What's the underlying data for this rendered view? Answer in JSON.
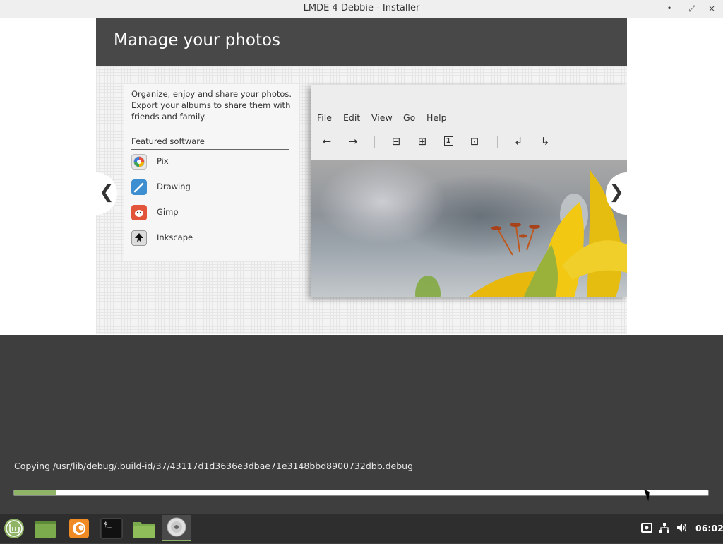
{
  "window": {
    "title": "LMDE 4 Debbie - Installer",
    "buttons": {
      "minimize": "•",
      "maximize": "⤢",
      "close": "×"
    }
  },
  "slide": {
    "title": "Manage your photos",
    "description": [
      "Organize, enjoy and share your photos.",
      "Export your albums to share them with",
      "friends and family."
    ],
    "featured_label": "Featured software",
    "software": [
      {
        "name": "Pix",
        "icon": "pix-icon"
      },
      {
        "name": "Drawing",
        "icon": "drawing-icon"
      },
      {
        "name": "Gimp",
        "icon": "gimp-icon"
      },
      {
        "name": "Inkscape",
        "icon": "inkscape-icon"
      }
    ],
    "nav": {
      "prev": "❮",
      "next": "❯"
    }
  },
  "app_preview": {
    "menu": [
      "File",
      "Edit",
      "View",
      "Go",
      "Help"
    ],
    "toolbar": {
      "back": "←",
      "forward": "→",
      "zoom_out": "⊟",
      "zoom_in": "⊞",
      "zoom_normal": "1",
      "zoom_fit": "⊡",
      "rotate_left": "↲",
      "rotate_right": "↳"
    }
  },
  "progress": {
    "status": "Copying /usr/lib/debug/.build-id/37/43117d1d3636e3dbae71e3148bbd8900732dbb.debug",
    "fraction": 0.06
  },
  "taskbar": {
    "apps": [
      "mint-menu-icon",
      "show-desktop-icon",
      "firefox-icon",
      "terminal-icon",
      "files-icon",
      "installer-icon"
    ],
    "clock": "06:02"
  },
  "colors": {
    "accent": "#8fb466",
    "header": "#484848",
    "panel": "#3e3e3e",
    "taskbar": "#2e2e2e"
  }
}
